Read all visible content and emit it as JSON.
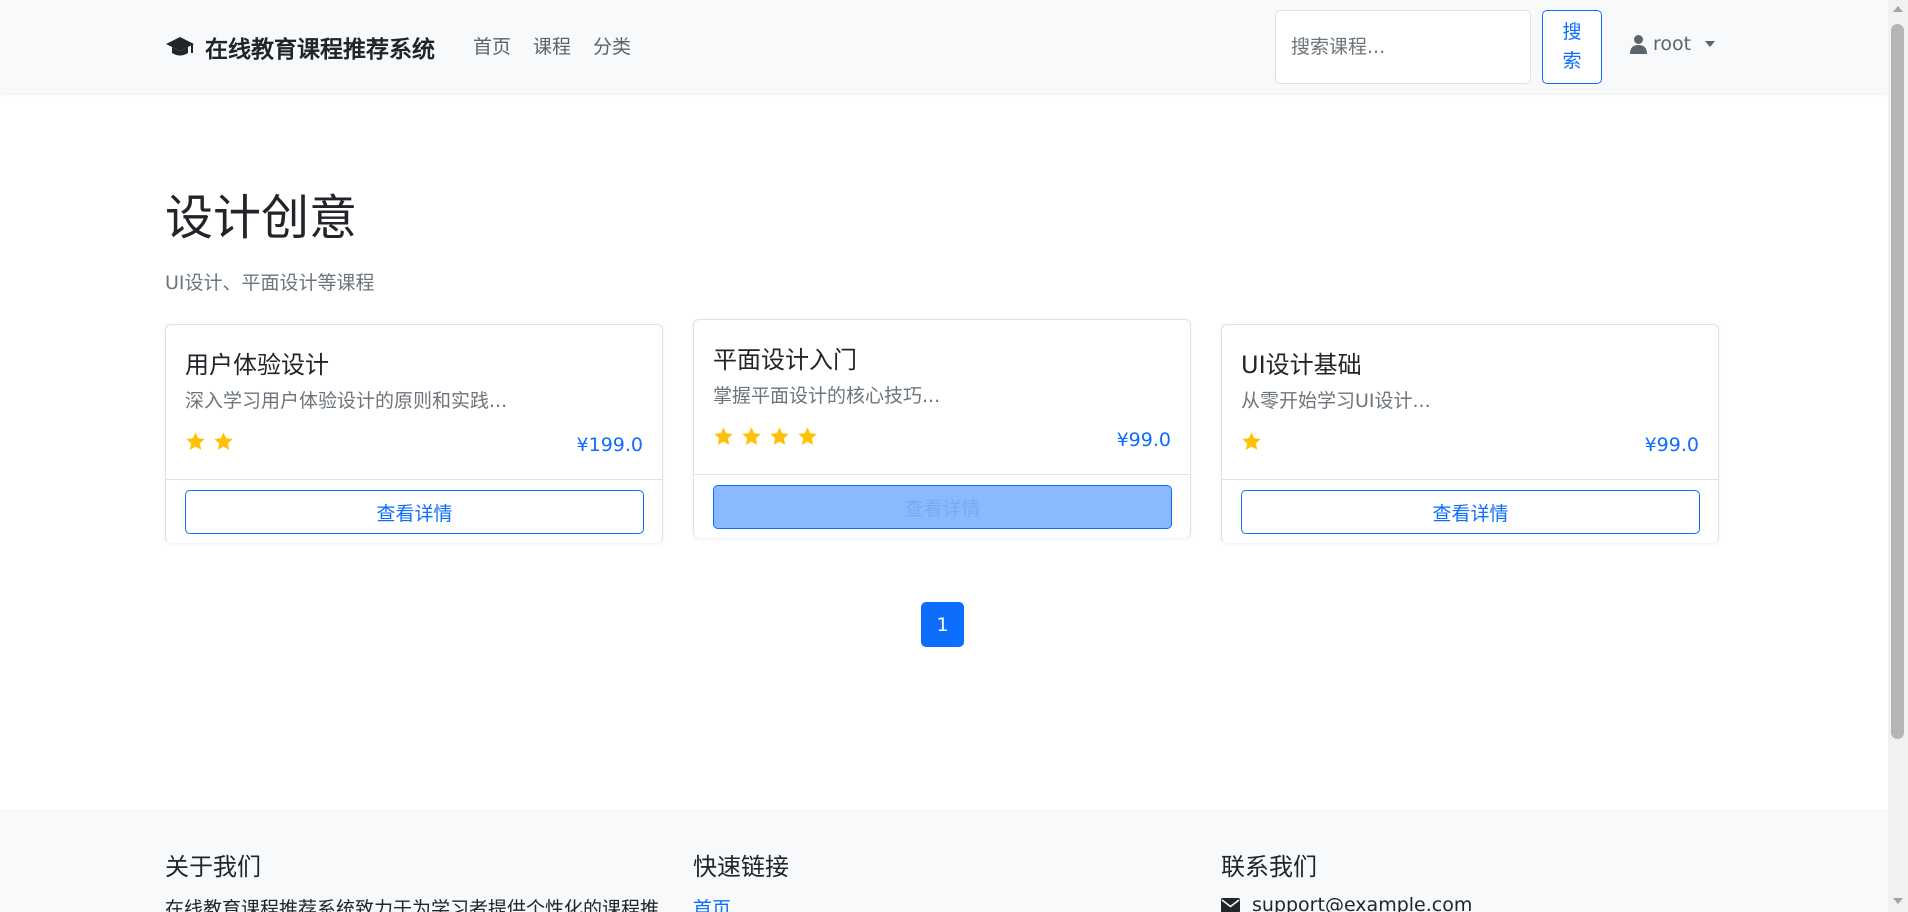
{
  "navbar": {
    "brand": "在线教育课程推荐系统",
    "links": [
      "首页",
      "课程",
      "分类"
    ],
    "search_placeholder": "搜索课程...",
    "search_button": "搜索",
    "user": "root"
  },
  "page": {
    "title": "设计创意",
    "description": "UI设计、平面设计等课程"
  },
  "courses": [
    {
      "title": "用户体验设计",
      "desc": "深入学习用户体验设计的原则和实践...",
      "stars": 2,
      "price": "¥199.0",
      "button": "查看详情"
    },
    {
      "title": "平面设计入门",
      "desc": "掌握平面设计的核心技巧...",
      "stars": 4,
      "price": "¥99.0",
      "button": "查看详情"
    },
    {
      "title": "UI设计基础",
      "desc": "从零开始学习UI设计...",
      "stars": 1,
      "price": "¥99.0",
      "button": "查看详情"
    }
  ],
  "pagination": {
    "current": "1"
  },
  "footer": {
    "about_title": "关于我们",
    "about_text": "在线教育课程推荐系统致力于为学习者提供个性化的课程推",
    "links_title": "快速链接",
    "links": [
      "首页"
    ],
    "contact_title": "联系我们",
    "email": "support@example.com"
  },
  "colors": {
    "primary": "#0d6efd",
    "star": "#ffc107",
    "navbar_bg": "#f8f9fa"
  },
  "icons": {
    "brand": "graduation-cap-icon",
    "user": "user-icon",
    "star": "star-icon",
    "email": "envelope-icon"
  }
}
